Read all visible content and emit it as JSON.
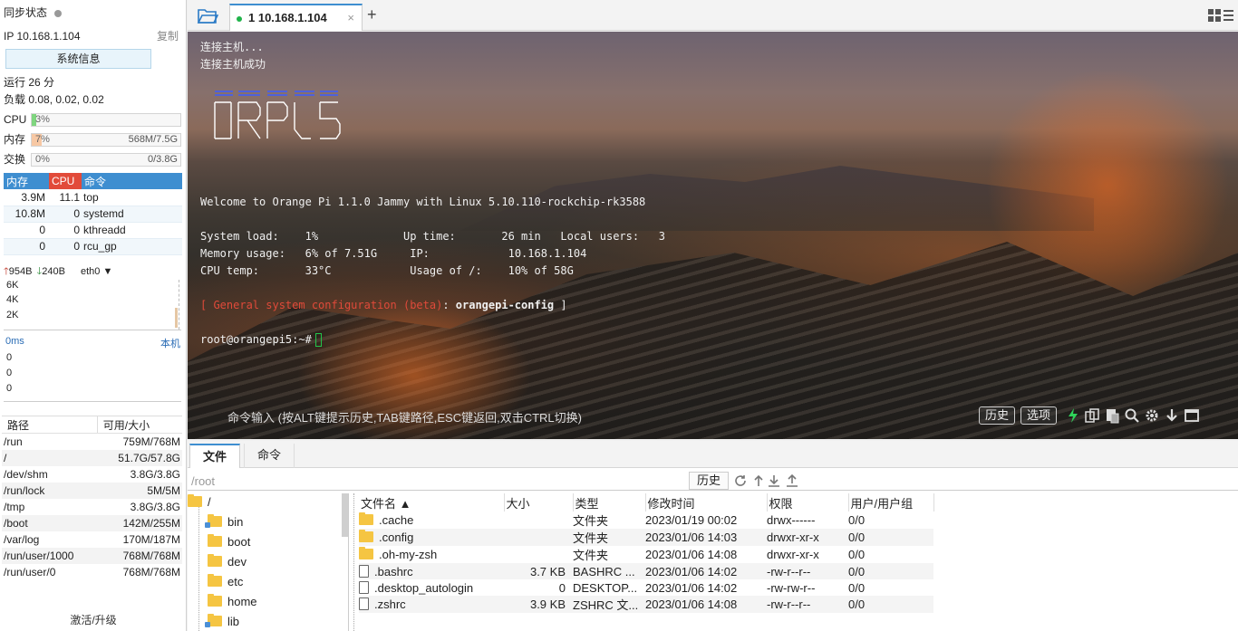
{
  "sidebar": {
    "sync_status": "同步状态",
    "ip": "IP 10.168.1.104",
    "copy": "复制",
    "sysinfo": "系统信息",
    "uptime": "运行 26 分",
    "load": "负载 0.08, 0.02, 0.02",
    "cpu": {
      "label": "CPU",
      "pct": "3%",
      "fraction": 0.03,
      "color": "#7fd67f"
    },
    "mem": {
      "label": "内存",
      "pct": "7%",
      "amount": "568M/7.5G",
      "fraction": 0.07,
      "color": "#f7c8a4"
    },
    "swap": {
      "label": "交换",
      "pct": "0%",
      "amount": "0/3.8G",
      "fraction": 0.0,
      "color": "#cccccc"
    },
    "proc_headers": {
      "mem": "内存",
      "cpu": "CPU",
      "cmd": "命令"
    },
    "processes": [
      {
        "mem": "3.9M",
        "cpu": "11.1",
        "cmd": "top"
      },
      {
        "mem": "10.8M",
        "cpu": "0",
        "cmd": "systemd"
      },
      {
        "mem": "0",
        "cpu": "0",
        "cmd": "kthreadd"
      },
      {
        "mem": "0",
        "cpu": "0",
        "cmd": "rcu_gp"
      }
    ],
    "net": {
      "up": "954B",
      "down": "240B",
      "iface": "eth0"
    },
    "net_axis": [
      "6K",
      "4K",
      "2K"
    ],
    "ping": {
      "latency": "0ms",
      "host": "本机",
      "axis": [
        "0",
        "0",
        "0"
      ]
    },
    "disk_headers": {
      "path": "路径",
      "size": "可用/大小"
    },
    "disks": [
      {
        "path": "/run",
        "size": "759M/768M"
      },
      {
        "path": "/",
        "size": "51.7G/57.8G"
      },
      {
        "path": "/dev/shm",
        "size": "3.8G/3.8G"
      },
      {
        "path": "/run/lock",
        "size": "5M/5M"
      },
      {
        "path": "/tmp",
        "size": "3.8G/3.8G"
      },
      {
        "path": "/boot",
        "size": "142M/255M"
      },
      {
        "path": "/var/log",
        "size": "170M/187M"
      },
      {
        "path": "/run/user/1000",
        "size": "768M/768M"
      },
      {
        "path": "/run/user/0",
        "size": "768M/768M"
      }
    ],
    "activate": "激活/升级"
  },
  "tabs": {
    "session_label": "1 10.168.1.104",
    "close": "×",
    "add": "+"
  },
  "terminal": {
    "line_connecting": "连接主机...",
    "line_connected": "连接主机成功",
    "welcome": "Welcome to Orange Pi 1.1.0 Jammy with Linux 5.10.110-rockchip-rk3588",
    "sysload_label": "System load:",
    "sysload": "1%",
    "uptime_label": "Up time:",
    "uptime": "26 min",
    "users_label": "Local users:",
    "users": "3",
    "mem_label": "Memory usage:",
    "mem": "6% of 7.51G",
    "ip_label": "IP:",
    "ip": "10.168.1.104",
    "temp_label": "CPU temp:",
    "temp": "33°C",
    "usage_label": "Usage of /:",
    "usage": "10% of 58G",
    "config_open": "[ ",
    "config_red": "General system configuration (beta)",
    "config_colon": ": ",
    "config_cmd": "orangepi-config",
    "config_close": " ]",
    "prompt": "root@orangepi5:~#",
    "cmd_hint": "命令输入 (按ALT键提示历史,TAB键路径,ESC键返回,双击CTRL切换)",
    "history": "历史",
    "options": "选项"
  },
  "files": {
    "tab_files": "文件",
    "tab_commands": "命令",
    "path": "/root",
    "history": "历史",
    "tree_root": "/",
    "tree": [
      "bin",
      "boot",
      "dev",
      "etc",
      "home",
      "lib"
    ],
    "tree_symlink": [
      true,
      false,
      false,
      false,
      false,
      true
    ],
    "headers": {
      "name": "文件名 ▲",
      "size": "大小",
      "type": "类型",
      "modified": "修改时间",
      "perm": "权限",
      "owner": "用户/用户组"
    },
    "rows": [
      {
        "name": ".cache",
        "size": "",
        "type": "文件夹",
        "modified": "2023/01/19 00:02",
        "perm": "drwx------",
        "owner": "0/0",
        "icon": "folder"
      },
      {
        "name": ".config",
        "size": "",
        "type": "文件夹",
        "modified": "2023/01/06 14:03",
        "perm": "drwxr-xr-x",
        "owner": "0/0",
        "icon": "folder"
      },
      {
        "name": ".oh-my-zsh",
        "size": "",
        "type": "文件夹",
        "modified": "2023/01/06 14:08",
        "perm": "drwxr-xr-x",
        "owner": "0/0",
        "icon": "folder"
      },
      {
        "name": ".bashrc",
        "size": "3.7 KB",
        "type": "BASHRC ...",
        "modified": "2023/01/06 14:02",
        "perm": "-rw-r--r--",
        "owner": "0/0",
        "icon": "file"
      },
      {
        "name": ".desktop_autologin",
        "size": "0",
        "type": "DESKTOP...",
        "modified": "2023/01/06 14:02",
        "perm": "-rw-rw-r--",
        "owner": "0/0",
        "icon": "file"
      },
      {
        "name": ".zshrc",
        "size": "3.9 KB",
        "type": "ZSHRC 文...",
        "modified": "2023/01/06 14:08",
        "perm": "-rw-r--r--",
        "owner": "0/0",
        "icon": "file"
      }
    ]
  }
}
